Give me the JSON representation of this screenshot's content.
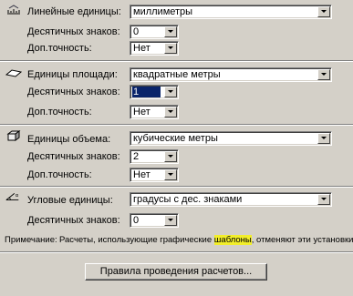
{
  "linear": {
    "label": "Линейные единицы:",
    "value": "миллиметры",
    "decimals_label": "Десятичных знаков:",
    "decimals_value": "0",
    "precision_label": "Доп.точность:",
    "precision_value": "Нет",
    "icon": "ruler-icon"
  },
  "area": {
    "label": "Единицы площади:",
    "value": "квадратные метры",
    "decimals_label": "Десятичных знаков:",
    "decimals_value": "1",
    "precision_label": "Доп.точность:",
    "precision_value": "Нет",
    "icon": "area-plane-icon"
  },
  "volume": {
    "label": "Единицы объема:",
    "value": "кубические метры",
    "decimals_label": "Десятичных знаков:",
    "decimals_value": "2",
    "precision_label": "Доп.точность:",
    "precision_value": "Нет",
    "icon": "cube-icon"
  },
  "angle": {
    "label": "Угловые единицы:",
    "value": "градусы с дес. знаками",
    "decimals_label": "Десятичных знаков:",
    "decimals_value": "0",
    "icon": "angle-icon"
  },
  "note": {
    "label": "Примечание:",
    "text_before": "Расчеты, использующие графические ",
    "highlighted": "шаблоны",
    "text_after": ", отменяют эти установки."
  },
  "calc_rules_button": "Правила проведения расчетов...",
  "colors": {
    "background": "#d4d0c8",
    "selection": "#0a246a",
    "highlight": "#f2ee2a"
  }
}
